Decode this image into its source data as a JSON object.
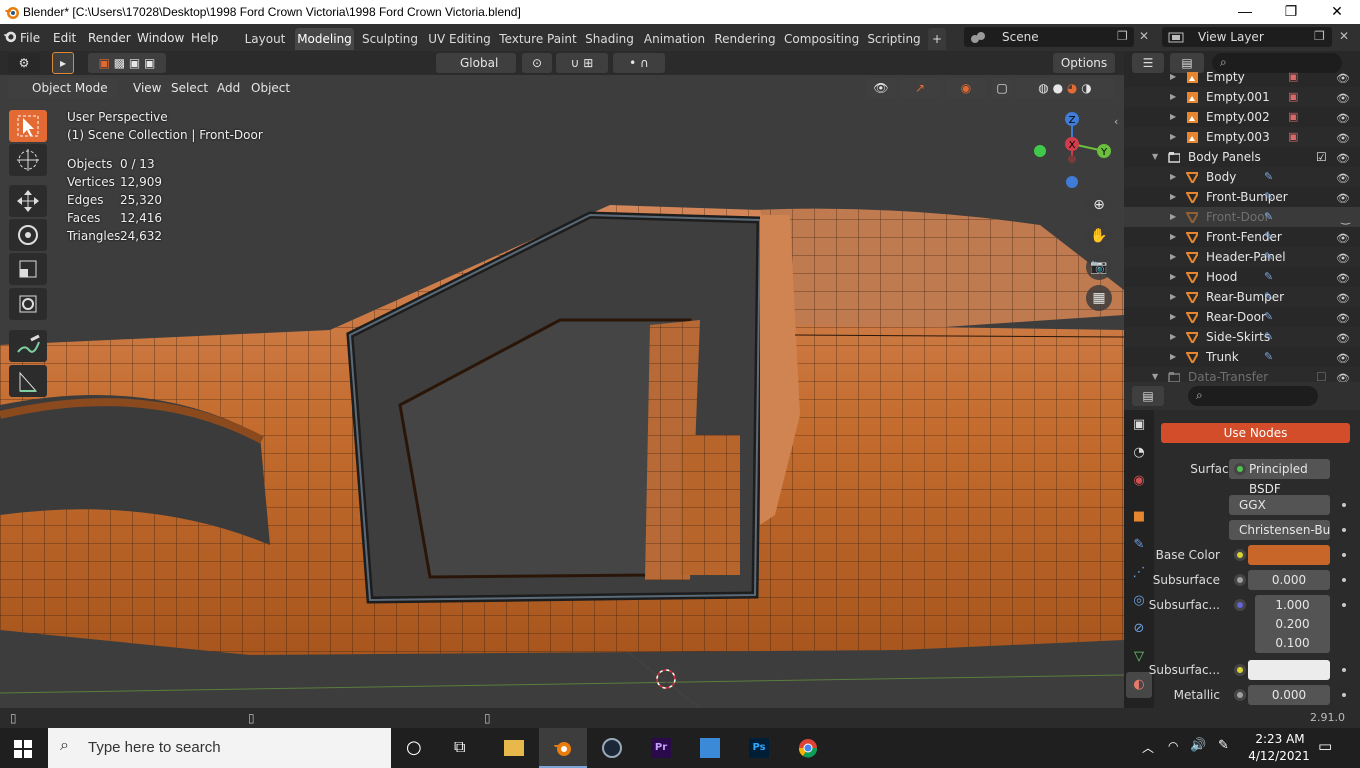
{
  "window": {
    "title": "Blender* [C:\\Users\\17028\\Desktop\\1998 Ford Crown Victoria\\1998 Ford Crown Victoria.blend]",
    "minimize": "—",
    "maximize": "❐",
    "close": "✕"
  },
  "menu": [
    "File",
    "Edit",
    "Render",
    "Window",
    "Help"
  ],
  "workspaces": [
    "Layout",
    "Modeling",
    "Sculpting",
    "UV Editing",
    "Texture Paint",
    "Shading",
    "Animation",
    "Rendering",
    "Compositing",
    "Scripting"
  ],
  "active_workspace": "Modeling",
  "add_tab": "+",
  "scene": {
    "label": "Scene"
  },
  "view_layer": {
    "label": "View Layer"
  },
  "header": {
    "orientation": "Global",
    "options": "Options",
    "mode": "Object Mode",
    "menus": [
      "View",
      "Select",
      "Add",
      "Object"
    ]
  },
  "viewport": {
    "perspective": "User Perspective",
    "collection": "(1) Scene Collection | Front-Door",
    "stats": [
      {
        "label": "Objects",
        "value": "0 / 13"
      },
      {
        "label": "Vertices",
        "value": "12,909"
      },
      {
        "label": "Edges",
        "value": "25,320"
      },
      {
        "label": "Faces",
        "value": "12,416"
      },
      {
        "label": "Triangles",
        "value": "24,632"
      }
    ],
    "gizmo": {
      "x": "X",
      "y": "Y",
      "z": "Z"
    }
  },
  "outliner": {
    "rows": [
      {
        "name": "Empty",
        "type": "empty",
        "indent": 1
      },
      {
        "name": "Empty.001",
        "type": "empty",
        "indent": 1
      },
      {
        "name": "Empty.002",
        "type": "empty",
        "indent": 1
      },
      {
        "name": "Empty.003",
        "type": "empty",
        "indent": 1
      },
      {
        "name": "Body Panels",
        "type": "collection",
        "indent": 0
      },
      {
        "name": "Body",
        "type": "mesh",
        "indent": 1
      },
      {
        "name": "Front-Bumper",
        "type": "mesh",
        "indent": 1
      },
      {
        "name": "Front-Door",
        "type": "mesh",
        "indent": 1,
        "hidden": true
      },
      {
        "name": "Front-Fender",
        "type": "mesh",
        "indent": 1
      },
      {
        "name": "Header-Panel",
        "type": "mesh",
        "indent": 1
      },
      {
        "name": "Hood",
        "type": "mesh",
        "indent": 1
      },
      {
        "name": "Rear-Bumper",
        "type": "mesh",
        "indent": 1
      },
      {
        "name": "Rear-Door",
        "type": "mesh",
        "indent": 1
      },
      {
        "name": "Side-Skirts",
        "type": "mesh",
        "indent": 1
      },
      {
        "name": "Trunk",
        "type": "mesh",
        "indent": 1
      },
      {
        "name": "Data-Transfer",
        "type": "collection",
        "indent": 0,
        "hidden": true
      }
    ]
  },
  "properties": {
    "use_nodes": "Use Nodes",
    "surface_label": "Surface",
    "surface_value": "Principled BSDF",
    "distribution": "GGX",
    "subsurface_method": "Christensen-Bu...",
    "base_color_label": "Base Color",
    "base_color": "#c8662a",
    "subsurface_label": "Subsurface",
    "subsurface_value": "0.000",
    "subsurface_radius_label": "Subsurfac...",
    "subsurface_radius": [
      "1.000",
      "0.200",
      "0.100"
    ],
    "subsurface_color_label": "Subsurfac...",
    "metallic_label": "Metallic",
    "metallic_value": "0.000"
  },
  "status": {
    "version": "2.91.0"
  },
  "taskbar": {
    "search_placeholder": "Type here to search",
    "time": "2:23 AM",
    "date": "4/12/2021",
    "pr": "Pr",
    "ps": "Ps"
  },
  "colors": {
    "accent": "#e36a32",
    "mesh": "#c8662a",
    "selected_tab": "#474747"
  }
}
